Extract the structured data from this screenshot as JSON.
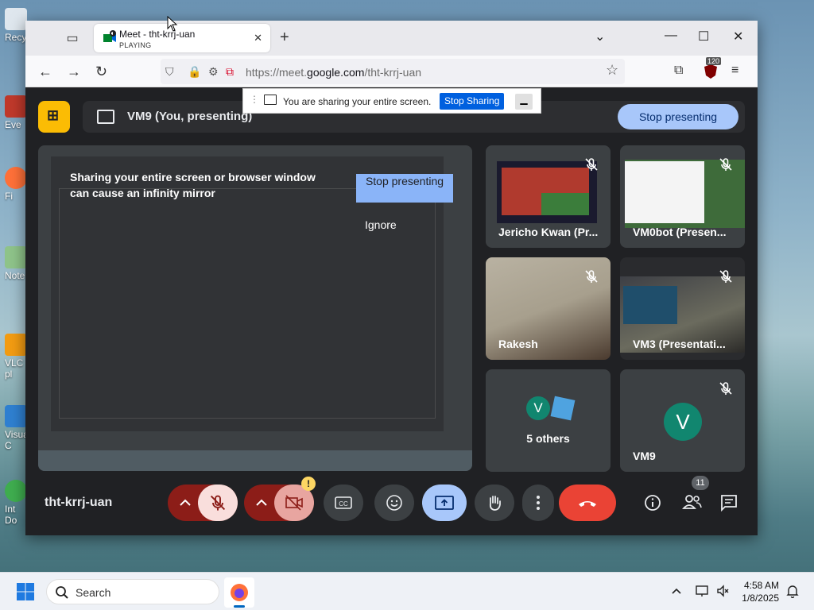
{
  "desktop": {
    "icons": [
      {
        "label": "Recy"
      },
      {
        "label": "Eve"
      },
      {
        "label": "Fi"
      },
      {
        "label": "Note"
      },
      {
        "label": "VLC"
      },
      {
        "label": "pl"
      },
      {
        "label": "Visua"
      },
      {
        "label": "C"
      },
      {
        "label": "Int"
      },
      {
        "label": "Do"
      }
    ]
  },
  "browser": {
    "tab_title": "Meet - tht-krrj-uan",
    "tab_status": "PLAYING",
    "url_prefix": "https://meet.",
    "url_domain": "google.com",
    "url_path": "/tht-krrj-uan",
    "extension_badge": "120"
  },
  "share_bar": {
    "message": "You are sharing your entire screen.",
    "stop_label": "Stop Sharing"
  },
  "meet": {
    "presenting_label": "VM9 (You, presenting)",
    "stop_presenting_label": "Stop presenting",
    "infinity_warning": "Sharing your entire screen or browser window can cause an infinity mirror",
    "warning_stop_label": "Stop presenting",
    "warning_ignore_label": "Ignore",
    "meeting_code": "tht-krrj-uan",
    "participant_count": "11",
    "participants": [
      {
        "name": "Jericho Kwan (Pr...",
        "muted": true
      },
      {
        "name": "VM0bot (Presen...",
        "muted": true
      },
      {
        "name": "Rakesh",
        "muted": true
      },
      {
        "name": "VM3 (Presentati...",
        "muted": true
      },
      {
        "name": "5 others",
        "avatar": "V"
      },
      {
        "name": "VM9",
        "avatar": "V",
        "muted": true
      }
    ],
    "colors": {
      "accent": "#a8c7fa",
      "end_call": "#ea4335",
      "muted_red": "#8c1d18",
      "meet_bg": "#202124",
      "tile_bg": "#3c4043"
    }
  },
  "taskbar": {
    "search_placeholder": "Search",
    "time": "4:58 AM",
    "date": "1/8/2025"
  }
}
